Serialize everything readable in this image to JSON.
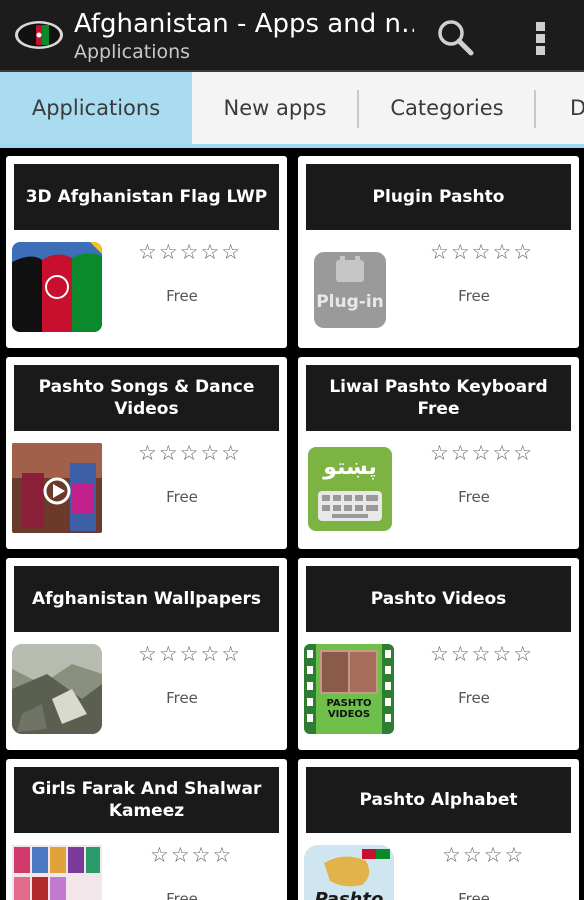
{
  "actionbar": {
    "title": "Afghanistan - Apps and n…",
    "subtitle": "Applications",
    "logo_icon": "afghanistan-flag-eye-icon",
    "search_icon": "search-icon",
    "overflow_icon": "overflow-menu-icon"
  },
  "tabs": [
    {
      "label": "Applications",
      "active": true
    },
    {
      "label": "New apps",
      "active": false
    },
    {
      "label": "Categories",
      "active": false
    },
    {
      "label": "D",
      "active": false
    }
  ],
  "apps": [
    {
      "title": "3D Afghanistan Flag LWP",
      "stars": "☆☆☆☆☆",
      "price": "Free",
      "icon": "afghanistan-flag-icon"
    },
    {
      "title": "Plugin Pashto",
      "stars": "☆☆☆☆☆",
      "price": "Free",
      "icon": "plug-in-icon",
      "icon_text": "Plug-in"
    },
    {
      "title": "Pashto Songs & Dance Videos",
      "stars": "☆☆☆☆☆",
      "price": "Free",
      "icon": "video-thumbnail-icon"
    },
    {
      "title": "Liwal Pashto Keyboard Free",
      "stars": "☆☆☆☆☆",
      "price": "Free",
      "icon": "keyboard-icon",
      "icon_text": "پښتو"
    },
    {
      "title": "Afghanistan Wallpapers",
      "stars": "☆☆☆☆☆",
      "price": "Free",
      "icon": "mountain-photo-icon"
    },
    {
      "title": "Pashto Videos",
      "stars": "☆☆☆☆☆",
      "price": "Free",
      "icon": "film-strip-icon",
      "icon_text": "PASHTO VIDEOS"
    },
    {
      "title": "Girls Farak And Shalwar Kameez",
      "stars": "☆☆☆☆",
      "price": "Free",
      "icon": "dress-gallery-icon"
    },
    {
      "title": "Pashto Alphabet",
      "stars": "☆☆☆☆",
      "price": "Free",
      "icon": "pashto-alphabet-icon",
      "icon_text": "Pashto"
    }
  ],
  "colors": {
    "actionbar": "#1c1c1c",
    "tab_active": "#a9dcf0",
    "tab_bg": "#f4f4f4",
    "card_title_bg": "#1a1a1a",
    "background": "#000000"
  }
}
